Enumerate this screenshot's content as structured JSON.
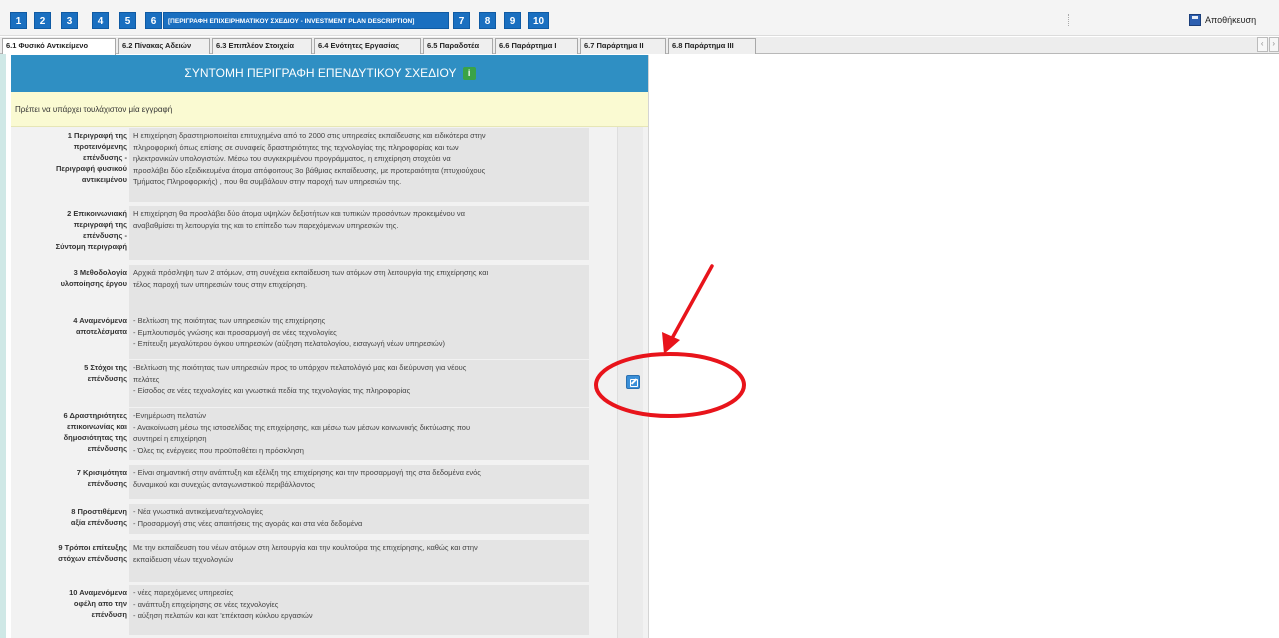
{
  "steps": [
    {
      "label": "1"
    },
    {
      "label": "2"
    },
    {
      "label": "3"
    },
    {
      "label": "4"
    },
    {
      "label": "5"
    },
    {
      "label": "6"
    },
    {
      "label": "[ΠΕΡΙΓΡΑΦΗ ΕΠΙΧΕΙΡΗΜΑΤΙΚΟΥ ΣΧΕΔΙΟΥ - INVESTMENT PLAN DESCRIPTION]"
    },
    {
      "label": "7"
    },
    {
      "label": "8"
    },
    {
      "label": "9"
    },
    {
      "label": "10"
    }
  ],
  "toolbar": {
    "save_label": "Αποθήκευση",
    "save_icon": "floppy-disk-icon"
  },
  "tabs": [
    {
      "label": "6.1 Φυσικό Αντικείμενο",
      "active": true
    },
    {
      "label": "6.2 Πίνακας Αδειών"
    },
    {
      "label": "6.3 Επιπλέον Στοιχεία"
    },
    {
      "label": "6.4 Ενότητες Εργασίας"
    },
    {
      "label": "6.5 Παραδοτέα"
    },
    {
      "label": "6.6 Παράρτημα Ι"
    },
    {
      "label": "6.7 Παράρτημα ΙΙ"
    },
    {
      "label": "6.8 Παράρτημα ΙΙΙ"
    }
  ],
  "tab_scroll": {
    "left": "‹",
    "right": "›"
  },
  "panel": {
    "title": "ΣΥΝΤΟΜΗ ΠΕΡΙΓΡΑΦΗ ΕΠΕΝΔΥΤΙΚΟΥ ΣΧΕΔΙΟΥ",
    "info_icon": "i",
    "notice": "Πρέπει να υπάρχει τουλάχιστον μία εγγραφή"
  },
  "rows": [
    {
      "label": [
        "1 Περιγραφή της",
        "προτεινόμενης",
        "επένδυσης -",
        "Περιγραφή φυσικού",
        "αντικειμένου"
      ],
      "text": [
        "Η επιχείρηση δραστηριοποιείται επιτυχημένα από το 2000 στις υπηρεσίες εκπαίδευσης και ειδικότερα στην",
        "πληροφορική όπως επίσης σε συναφείς δραστηριότητες της τεχνολογίας της πληροφορίας και των",
        "ηλεκτρονικών υπολογιστών. Μέσω του συγκεκριμένου προγράμματος, η επιχείρηση στοχεύει να",
        "προσλάβει δύο εξειδικευμένα άτομα απόφοιτους 3ο βάθμιας εκπαίδευσης, με προτεραιότητα (πτυχιούχους",
        "Τμήματος Πληροφορικής) , που θα συμβάλουν στην παροχή των υπηρεσιών της."
      ]
    },
    {
      "label": [
        "2 Επικοινωνιακή",
        "περιγραφή της",
        "επένδυσης -",
        "Σύντομη περιγραφή"
      ],
      "text": [
        "Η επιχείρηση θα προσλάβει δύο άτομα υψηλών δεξιοτήτων και τυπικών προσόντων προκειμένου να",
        "αναβαθμίσει τη λειτουργία της και το επίπεδο των παρεχόμενων υπηρεσιών της."
      ]
    },
    {
      "label": [
        "3 Μεθοδολογία",
        "υλοποίησης έργου"
      ],
      "text": [
        "Αρχικά πρόσληψη των 2 ατόμων, στη συνέχεια εκπαίδευση των ατόμων στη λειτουργία της επιχείρησης και",
        "τέλος παροχή των υπηρεσιών τους στην επιχείρηση."
      ]
    },
    {
      "label": [
        "4 Αναμενόμενα",
        "αποτελέσματα"
      ],
      "text": [
        "- Βελτίωση της ποιότητας των υπηρεσιών της επιχείρησης",
        "- Εμπλουτισμός γνώσης και προσαρμογή σε νέες τεχνολογίες",
        "- Επίτευξη μεγαλύτερου όγκου υπηρεσιών (αύξηση πελατολογίου, εισαγωγή νέων υπηρεσιών)"
      ]
    },
    {
      "label": [
        "5 Στόχοι της",
        "επένδυσης"
      ],
      "text": [
        "-Βελτίωση της ποιότητας των υπηρεσιών προς το υπάρχον πελατολόγιό μας και διεύρυνση για νέους",
        "πελάτες",
        "- Είσοδος σε νέες τεχνολογίες και γνωστικά πεδία της τεχνολογίας της πληροφορίας"
      ]
    },
    {
      "label": [
        "6 Δραστηριότητες",
        "επικοινωνίας και",
        "δημοσιότητας της",
        "επένδυσης"
      ],
      "text": [
        "-Ενημέρωση πελατών",
        "- Ανακοίνωση μέσω της ιστοσελίδας της επιχείρησης, και μέσω των μέσων κοινωνικής δικτύωσης που",
        "συντηρεί η επιχείρηση",
        "- Όλες τις ενέργειες που προϋποθέτει η πρόσκληση"
      ]
    },
    {
      "label": [
        "7 Κρισιμότητα",
        "επένδυσης"
      ],
      "text": [
        "- Είναι σημαντική στην ανάπτυξη και εξέλιξη της επιχείρησης και την προσαρμογή της στα δεδομένα ενός",
        "δυναμικού και συνεχώς ανταγωνιστικού περιβάλλοντος"
      ]
    },
    {
      "label": [
        "8 Προστιθέμενη",
        "αξία επένδυσης"
      ],
      "text": [
        "- Νέα γνωστικά αντικείμενα/τεχνολογίες",
        "- Προσαρμογή στις νέες απαιτήσεις της αγοράς και στα νέα δεδομένα"
      ]
    },
    {
      "label": [
        "9 Τρόποι επίτευξης",
        "στόχων επένδυσης"
      ],
      "text": [
        "Με την εκπαίδευση του νέων ατόμων στη λειτουργία και την κουλτούρα της επιχείρησης, καθώς και στην",
        "εκπαίδευση νέων τεχνολογιών"
      ]
    },
    {
      "label": [
        "10 Αναμενόμενα",
        "οφέλη απο την",
        "επένδυση"
      ],
      "text": [
        "- νέες παρεχόμενες υπηρεσίες",
        "- ανάπτυξη επιχείρησης σε νέες τεχνολογίες",
        "- αύξηση πελατών και κατ 'επέκταση κύκλου εργασιών"
      ]
    }
  ],
  "edit_icon": "edit-icon",
  "colors": {
    "step_blue": "#1a6fc0",
    "header_blue": "#2f8fc3",
    "notice_yellow": "#fafad2",
    "annotation_red": "#e8141b",
    "info_green": "#3aa346"
  }
}
